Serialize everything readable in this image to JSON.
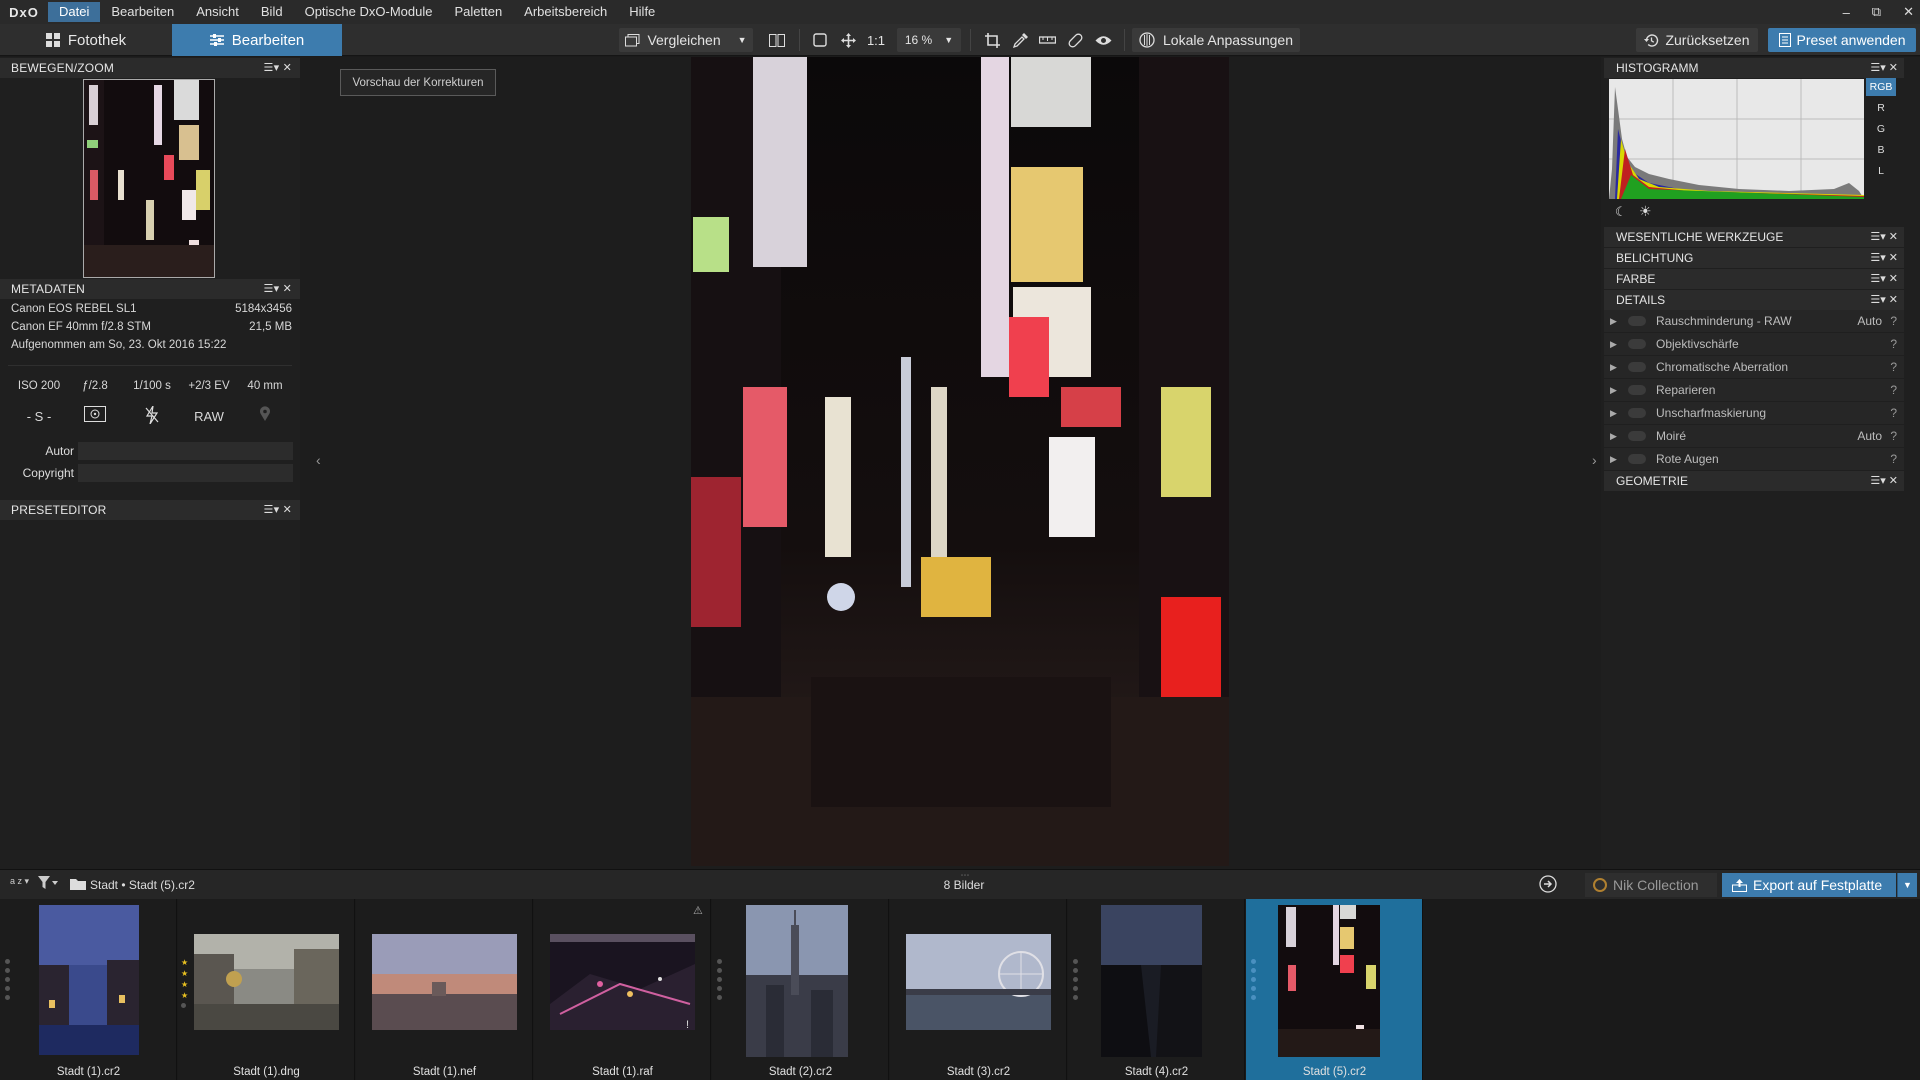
{
  "app": {
    "logo": "DxO"
  },
  "menu": [
    "Datei",
    "Bearbeiten",
    "Ansicht",
    "Bild",
    "Optische DxO-Module",
    "Paletten",
    "Arbeitsbereich",
    "Hilfe"
  ],
  "window_controls": {
    "minimize": "–",
    "restore": "⧉",
    "close": "✕"
  },
  "toolbar": {
    "tab_library": "Fotothek",
    "tab_edit": "Bearbeiten",
    "compare": "Vergleichen",
    "one_to_one": "1:1",
    "zoom": "16 %",
    "local_adjustments": "Lokale Anpassungen",
    "reset": "Zurücksetzen",
    "apply_preset": "Preset anwenden"
  },
  "left": {
    "move_zoom_title": "BEWEGEN/ZOOM",
    "metadata_title": "METADATEN",
    "camera": "Canon EOS REBEL SL1",
    "dimensions": "5184x3456",
    "lens": "Canon EF 40mm f/2.8 STM",
    "filesize": "21,5 MB",
    "captured": "Aufgenommen am So, 23. Okt 2016 15:22",
    "exif": {
      "iso": "ISO 200",
      "aperture": "ƒ/2.8",
      "shutter": "1/100 s",
      "ev": "+2/3 EV",
      "focal": "40 mm"
    },
    "mode": {
      "program": "- S -",
      "raw": "RAW"
    },
    "author_label": "Autor",
    "copyright_label": "Copyright",
    "preset_editor_title": "PRESETEDITOR"
  },
  "center": {
    "preview_button": "Vorschau der Korrekturen"
  },
  "right": {
    "histogram_title": "HISTOGRAMM",
    "channels": [
      "RGB",
      "R",
      "G",
      "B",
      "L"
    ],
    "sections": [
      "WESENTLICHE WERKZEUGE",
      "BELICHTUNG",
      "FARBE",
      "DETAILS"
    ],
    "details_items": [
      {
        "label": "Rauschminderung - RAW",
        "value": "Auto"
      },
      {
        "label": "Objektivschärfe",
        "value": ""
      },
      {
        "label": "Chromatische Aberration",
        "value": ""
      },
      {
        "label": "Reparieren",
        "value": ""
      },
      {
        "label": "Unscharfmaskierung",
        "value": ""
      },
      {
        "label": "Moiré",
        "value": "Auto"
      },
      {
        "label": "Rote Augen",
        "value": ""
      }
    ],
    "help_glyph": "?",
    "geometry_title": "GEOMETRIE"
  },
  "filmbar": {
    "sort_label": "a z",
    "path_folder": "Stadt",
    "path_separator": "•",
    "path_file": "Stadt (5).cr2",
    "count": "8 Bilder",
    "nik": "Nik Collection",
    "export": "Export auf Festplatte"
  },
  "thumbnails": [
    {
      "name": "Stadt (1).cr2",
      "stars": 0
    },
    {
      "name": "Stadt (1).dng",
      "stars": 4
    },
    {
      "name": "Stadt (1).nef",
      "stars": 0
    },
    {
      "name": "Stadt (1).raf",
      "stars": 0
    },
    {
      "name": "Stadt (2).cr2",
      "stars": 0
    },
    {
      "name": "Stadt (3).cr2",
      "stars": 0
    },
    {
      "name": "Stadt (4).cr2",
      "stars": 0
    },
    {
      "name": "Stadt (5).cr2",
      "stars": 0
    }
  ],
  "colors": {
    "accent": "#3d7cae",
    "selected_thumb": "#1f6f9c",
    "panel_bg": "#1f1f1f"
  }
}
